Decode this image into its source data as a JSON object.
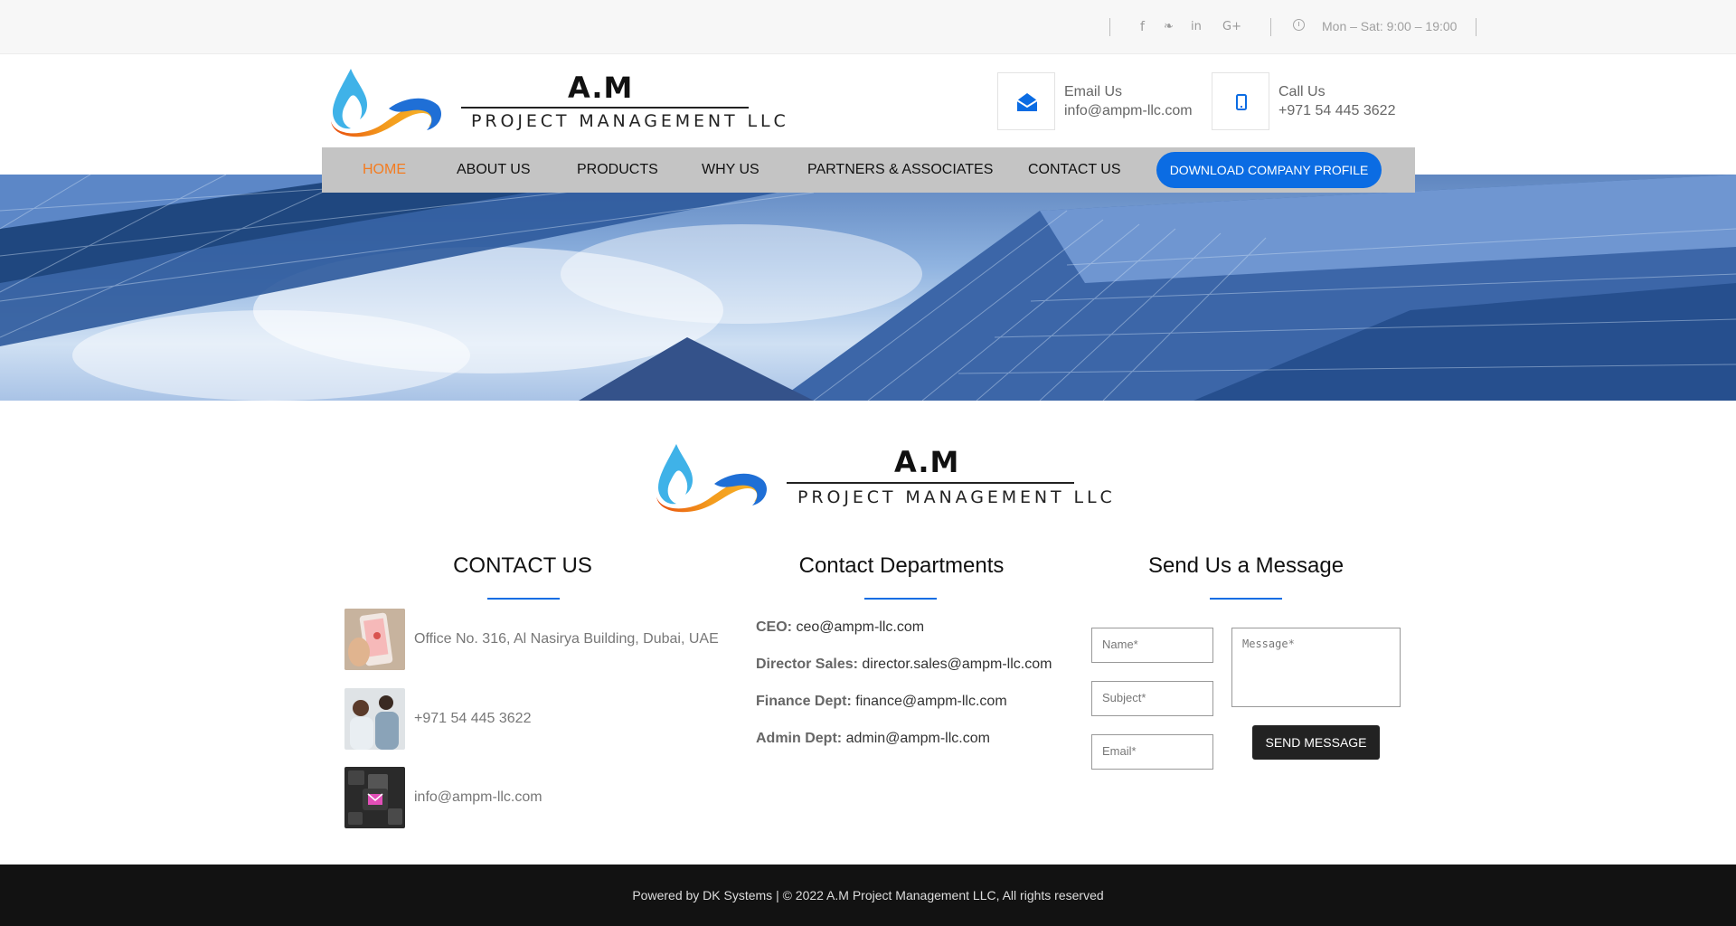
{
  "topbar": {
    "social": [
      {
        "icon": "facebook-icon",
        "glyph": "f"
      },
      {
        "icon": "twitter-icon",
        "glyph": "❧"
      },
      {
        "icon": "linkedin-icon",
        "glyph": "in"
      },
      {
        "icon": "google-plus-icon",
        "glyph": "G+"
      }
    ],
    "hours": "Mon – Sat: 9:00 – 19:00"
  },
  "brand": {
    "name": "A.M",
    "subtitle": "PROJECT MANAGEMENT LLC"
  },
  "header": {
    "email_label": "Email Us",
    "email_value": "info@ampm-llc.com",
    "call_label": "Call Us",
    "call_value": "+971 54 445 3622"
  },
  "nav": {
    "items": [
      "HOME",
      "ABOUT US",
      "PRODUCTS",
      "WHY US",
      "PARTNERS & ASSOCIATES",
      "CONTACT US"
    ],
    "download": "DOWNLOAD COMPANY PROFILE"
  },
  "contact": {
    "title": "CONTACT US",
    "address": "Office No. 316, Al Nasirya Building, Dubai, UAE",
    "phone": "+971 54 445 3622",
    "email": "info@ampm-llc.com"
  },
  "departments": {
    "title": "Contact Departments",
    "list": [
      {
        "label": "CEO:",
        "value": "ceo@ampm-llc.com"
      },
      {
        "label": "Director Sales:",
        "value": "director.sales@ampm-llc.com"
      },
      {
        "label": "Finance Dept:",
        "value": "finance@ampm-llc.com"
      },
      {
        "label": "Admin Dept:",
        "value": "admin@ampm-llc.com"
      }
    ]
  },
  "message": {
    "title": "Send Us a Message",
    "name_placeholder": "Name*",
    "subject_placeholder": "Subject*",
    "email_placeholder": "Email*",
    "message_placeholder": "Message*",
    "send": "SEND MESSAGE"
  },
  "footer": {
    "text": "Powered by DK Systems | © 2022 A.M Project Management LLC, All rights reserved"
  },
  "colors": {
    "accent": "#0b6ce3",
    "active_nav": "#f47c20",
    "footer_bg": "#121212"
  }
}
